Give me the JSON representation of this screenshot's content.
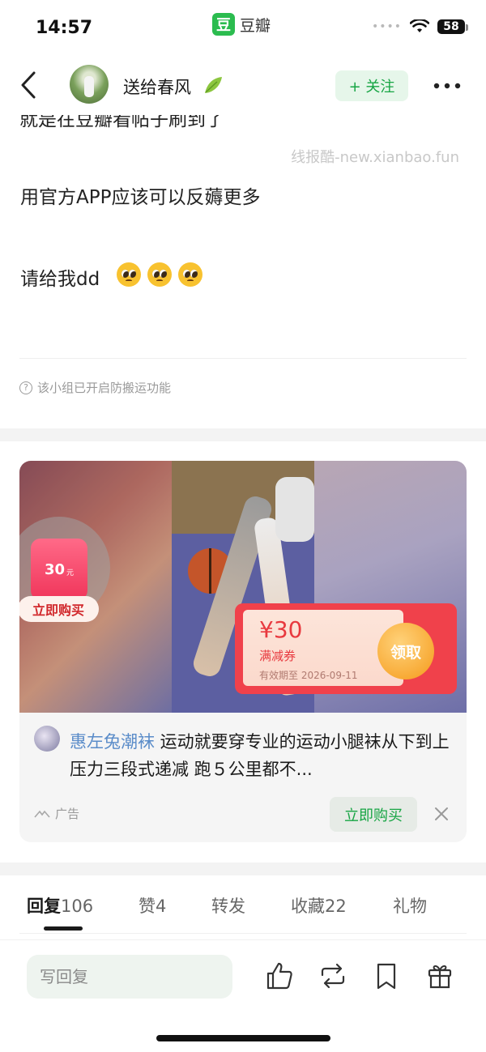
{
  "status_bar": {
    "time": "14:57",
    "app_logo": "豆",
    "app_name": "豆瓣",
    "battery": "58",
    "icons": [
      "signal-dots-icon",
      "wifi-icon",
      "battery-icon"
    ]
  },
  "nav": {
    "username": "送给春风",
    "follow_label": "+ 关注",
    "icons": [
      "back-icon",
      "leaf-icon",
      "more-icon"
    ]
  },
  "post": {
    "cut_line": "就是在豆瓣看帖子刷到了",
    "watermark": "线报酷-new.xianbao.fun",
    "line1": "用官方APP应该可以反薅更多",
    "line2": "请给我dd",
    "emoji_count": 3,
    "notice": "该小组已开启防搬运功能"
  },
  "ad": {
    "coupon_small_amount": "30",
    "coupon_small_unit": "元",
    "buy_pill": "立即购买",
    "coupon_amount": "¥30",
    "coupon_type": "满减券",
    "coupon_expiry": "有效期至 2026-09-11",
    "claim_label": "领取",
    "author": "惠左兔潮袜",
    "text": " 运动就要穿专业的运动小腿袜从下到上压力三段式递减 跑５公里都不...",
    "tag": "广告",
    "buy_button": "立即购买"
  },
  "tabs": [
    {
      "label": "回复",
      "count": "106"
    },
    {
      "label": "赞",
      "count": "4"
    },
    {
      "label": "转发",
      "count": ""
    },
    {
      "label": "收藏",
      "count": "22"
    },
    {
      "label": "礼物",
      "count": ""
    }
  ],
  "bottom": {
    "reply_placeholder": "写回复",
    "icons": [
      "like-icon",
      "repost-icon",
      "bookmark-icon",
      "gift-icon"
    ]
  },
  "colors": {
    "brand_green": "#17a544",
    "coupon_red": "#f0414b",
    "author_blue": "#5a8cc9"
  }
}
